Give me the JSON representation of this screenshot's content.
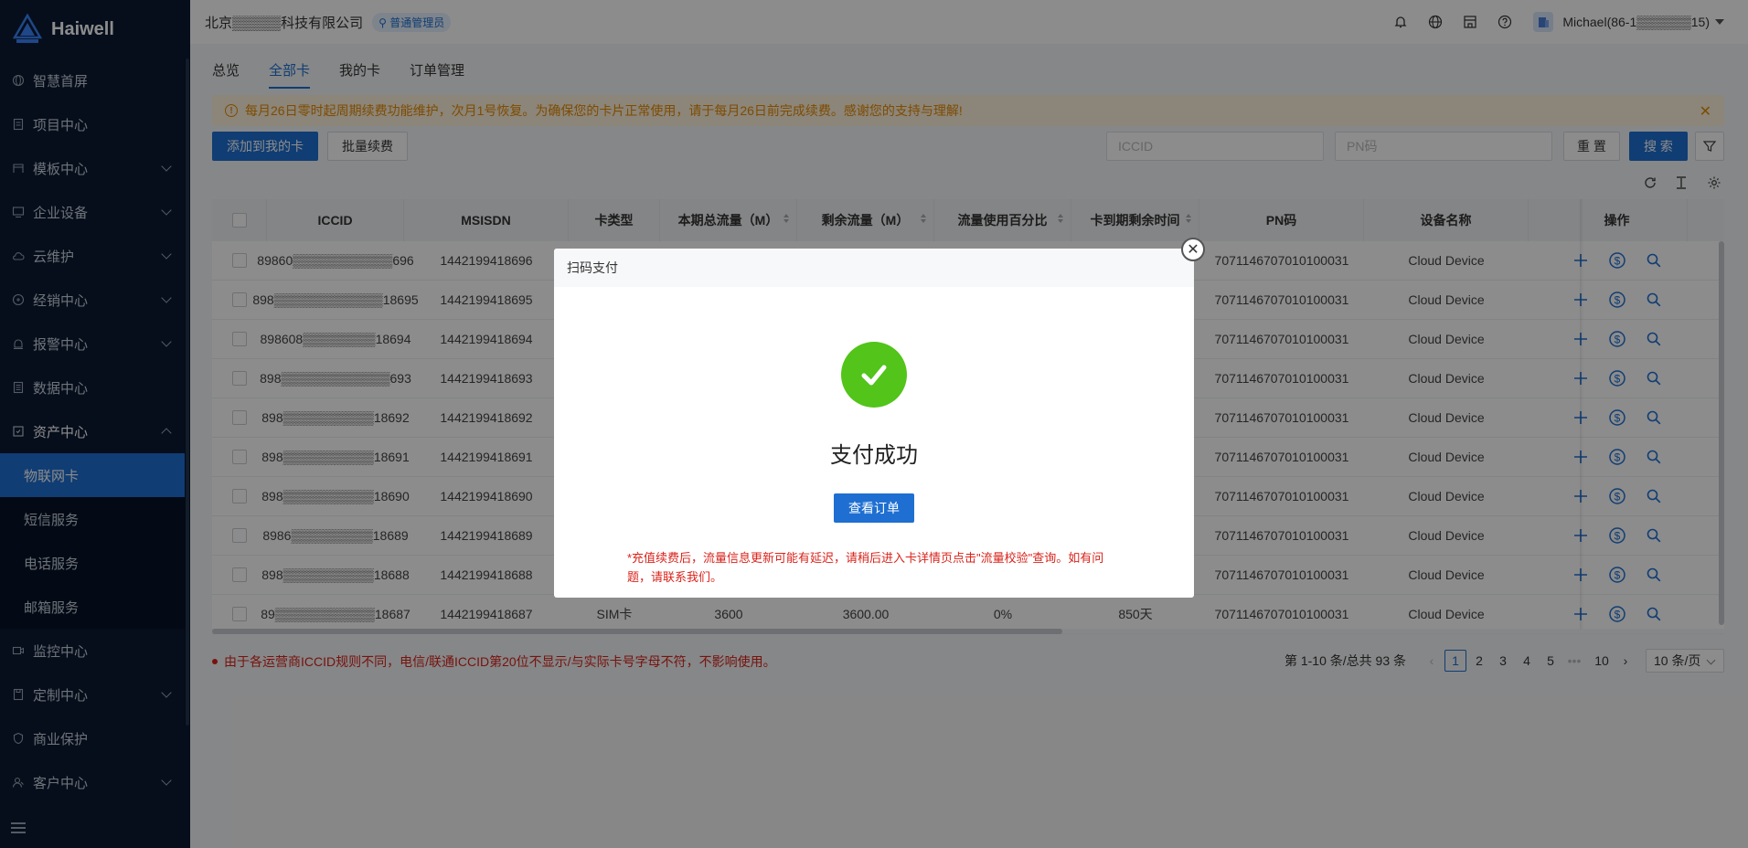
{
  "app": {
    "brand": "Haiwell"
  },
  "sidebar": {
    "items": [
      {
        "label": "智慧首屏",
        "icon": "globe-icon",
        "expandable": false
      },
      {
        "label": "项目中心",
        "icon": "document-icon",
        "expandable": false
      },
      {
        "label": "模板中心",
        "icon": "template-icon",
        "expandable": true
      },
      {
        "label": "企业设备",
        "icon": "monitor-icon",
        "expandable": true
      },
      {
        "label": "云维护",
        "icon": "cloud-icon",
        "expandable": true
      },
      {
        "label": "经销中心",
        "icon": "dealer-icon",
        "expandable": true
      },
      {
        "label": "报警中心",
        "icon": "alarm-icon",
        "expandable": true
      },
      {
        "label": "数据中心",
        "icon": "data-icon",
        "expandable": false
      },
      {
        "label": "资产中心",
        "icon": "asset-icon",
        "expandable": true,
        "expanded": true
      }
    ],
    "sub_items": [
      {
        "label": "物联网卡",
        "active": true
      },
      {
        "label": "短信服务",
        "active": false
      },
      {
        "label": "电话服务",
        "active": false
      },
      {
        "label": "邮箱服务",
        "active": false
      }
    ],
    "items_after": [
      {
        "label": "监控中心",
        "icon": "video-icon",
        "expandable": false
      },
      {
        "label": "定制中心",
        "icon": "custom-icon",
        "expandable": true
      },
      {
        "label": "商业保护",
        "icon": "shield-icon",
        "expandable": false
      },
      {
        "label": "客户中心",
        "icon": "customer-icon",
        "expandable": true
      }
    ]
  },
  "header": {
    "company": "北京▒▒▒▒▒科技有限公司",
    "role": "普通管理员",
    "username": "Michael(86-1▒▒▒▒▒▒15)"
  },
  "tabs": [
    {
      "label": "总览",
      "active": false
    },
    {
      "label": "全部卡",
      "active": true
    },
    {
      "label": "我的卡",
      "active": false
    },
    {
      "label": "订单管理",
      "active": false
    }
  ],
  "notice": {
    "text": "每月26日零时起周期续费功能维护，次月1号恢复。为确保您的卡片正常使用，请于每月26日前完成续费。感谢您的支持与理解!"
  },
  "toolbar": {
    "add_label": "添加到我的卡",
    "batch_label": "批量续费",
    "iccid_placeholder": "ICCID",
    "pn_placeholder": "PN码",
    "reset_label": "重 置",
    "search_label": "搜 索"
  },
  "table": {
    "columns": [
      "ICCID",
      "MSISDN",
      "卡类型",
      "本期总流量（M）",
      "剩余流量（M）",
      "流量使用百分比",
      "卡到期剩余时间",
      "PN码",
      "设备名称",
      "操作"
    ],
    "rows": [
      {
        "iccid": "89860▒▒▒▒▒▒▒▒▒▒▒696",
        "msisdn": "1442199418696",
        "type": "",
        "total": "",
        "remain": "",
        "pct": "",
        "days": "",
        "pn": "7071146707010100031",
        "device": "Cloud Device"
      },
      {
        "iccid": "898▒▒▒▒▒▒▒▒▒▒▒▒18695",
        "msisdn": "1442199418695",
        "type": "",
        "total": "",
        "remain": "",
        "pct": "",
        "days": "",
        "pn": "7071146707010100031",
        "device": "Cloud Device"
      },
      {
        "iccid": "898608▒▒▒▒▒▒▒▒18694",
        "msisdn": "1442199418694",
        "type": "",
        "total": "",
        "remain": "",
        "pct": "",
        "days": "",
        "pn": "7071146707010100031",
        "device": "Cloud Device"
      },
      {
        "iccid": "898▒▒▒▒▒▒▒▒▒▒▒▒693",
        "msisdn": "1442199418693",
        "type": "",
        "total": "",
        "remain": "",
        "pct": "",
        "days": "",
        "pn": "7071146707010100031",
        "device": "Cloud Device"
      },
      {
        "iccid": "898▒▒▒▒▒▒▒▒▒▒18692",
        "msisdn": "1442199418692",
        "type": "",
        "total": "",
        "remain": "",
        "pct": "",
        "days": "",
        "pn": "7071146707010100031",
        "device": "Cloud Device"
      },
      {
        "iccid": "898▒▒▒▒▒▒▒▒▒▒18691",
        "msisdn": "1442199418691",
        "type": "",
        "total": "",
        "remain": "",
        "pct": "",
        "days": "",
        "pn": "7071146707010100031",
        "device": "Cloud Device"
      },
      {
        "iccid": "898▒▒▒▒▒▒▒▒▒▒18690",
        "msisdn": "1442199418690",
        "type": "",
        "total": "",
        "remain": "",
        "pct": "",
        "days": "",
        "pn": "7071146707010100031",
        "device": "Cloud Device"
      },
      {
        "iccid": "8986▒▒▒▒▒▒▒▒▒18689",
        "msisdn": "1442199418689",
        "type": "",
        "total": "",
        "remain": "",
        "pct": "",
        "days": "",
        "pn": "7071146707010100031",
        "device": "Cloud Device"
      },
      {
        "iccid": "898▒▒▒▒▒▒▒▒▒▒18688",
        "msisdn": "1442199418688",
        "type": "",
        "total": "",
        "remain": "",
        "pct": "",
        "days": "",
        "pn": "7071146707010100031",
        "device": "Cloud Device"
      },
      {
        "iccid": "89▒▒▒▒▒▒▒▒▒▒▒18687",
        "msisdn": "1442199418687",
        "type": "SIM卡",
        "total": "3600",
        "remain": "3600.00",
        "pct": "0%",
        "days": "850天",
        "pn": "7071146707010100031",
        "device": "Cloud Device"
      }
    ]
  },
  "footnote": "由于各运营商ICCID规则不同，电信/联通ICCID第20位不显示/与实际卡号字母不符，不影响使用。",
  "pagination": {
    "summary": "第 1-10 条/总共 93 条",
    "pages": [
      "1",
      "2",
      "3",
      "4",
      "5"
    ],
    "ellipsis": "•••",
    "last": "10",
    "page_size": "10 条/页"
  },
  "modal": {
    "title": "扫码支付",
    "status": "支付成功",
    "button": "查看订单",
    "note": "*充值续费后，流量信息更新可能有延迟，请稍后进入卡详情页点击\"流量校验\"查询。如有问题，请联系我们。"
  },
  "colors": {
    "primary": "#1e6fd1",
    "success": "#52c41a",
    "danger": "#d9231b",
    "sidebar_bg": "#0b1b33",
    "warning": "#e58a00"
  }
}
